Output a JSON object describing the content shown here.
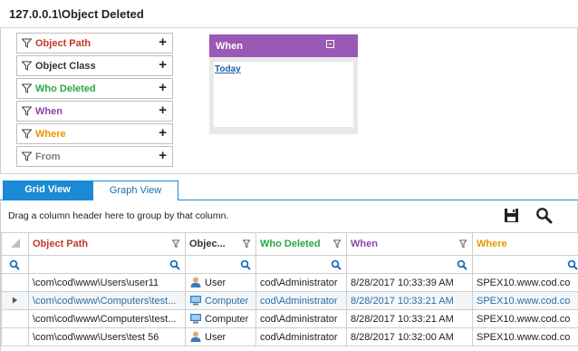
{
  "title": "127.0.0.1\\Object Deleted",
  "filters": [
    {
      "label": "Object Path",
      "color": "#c0392b"
    },
    {
      "label": "Object Class",
      "color": "#333333"
    },
    {
      "label": "Who Deleted",
      "color": "#27a745"
    },
    {
      "label": "When",
      "color": "#8e44ad"
    },
    {
      "label": "Where",
      "color": "#e69500"
    },
    {
      "label": "From",
      "color": "#7f7f7f"
    }
  ],
  "filter_add_symbol": "+",
  "when_panel": {
    "title": "When",
    "link": "Today",
    "color": "#9b59b6"
  },
  "tabs": {
    "grid": "Grid View",
    "graph": "Graph View",
    "active_color": "#1a8ad4"
  },
  "group_hint": "Drag a column header here to group by that column.",
  "columns": [
    {
      "label": "Object Path",
      "color": "#c0392b"
    },
    {
      "label": "Objec...",
      "color": "#333333"
    },
    {
      "label": "Who Deleted",
      "color": "#27a745"
    },
    {
      "label": "When",
      "color": "#8e44ad"
    },
    {
      "label": "Where",
      "color": "#e69500"
    }
  ],
  "rows": [
    {
      "path": "\\com\\cod\\www\\Users\\user11",
      "class": "User",
      "class_icon": "user-icon",
      "who": "cod\\Administrator",
      "when": "8/28/2017 10:33:39 AM",
      "where": "SPEX10.www.cod.co",
      "selected": false
    },
    {
      "path": "\\com\\cod\\www\\Computers\\test...",
      "class": "Computer",
      "class_icon": "computer-icon",
      "who": "cod\\Administrator",
      "when": "8/28/2017 10:33:21 AM",
      "where": "SPEX10.www.cod.co",
      "selected": true
    },
    {
      "path": "\\com\\cod\\www\\Computers\\test...",
      "class": "Computer",
      "class_icon": "computer-icon",
      "who": "cod\\Administrator",
      "when": "8/28/2017 10:33:21 AM",
      "where": "SPEX10.www.cod.co",
      "selected": false
    },
    {
      "path": "\\com\\cod\\www\\Users\\test 56",
      "class": "User",
      "class_icon": "user-icon",
      "who": "cod\\Administrator",
      "when": "8/28/2017 10:32:00 AM",
      "where": "SPEX10.www.cod.co",
      "selected": false
    }
  ]
}
